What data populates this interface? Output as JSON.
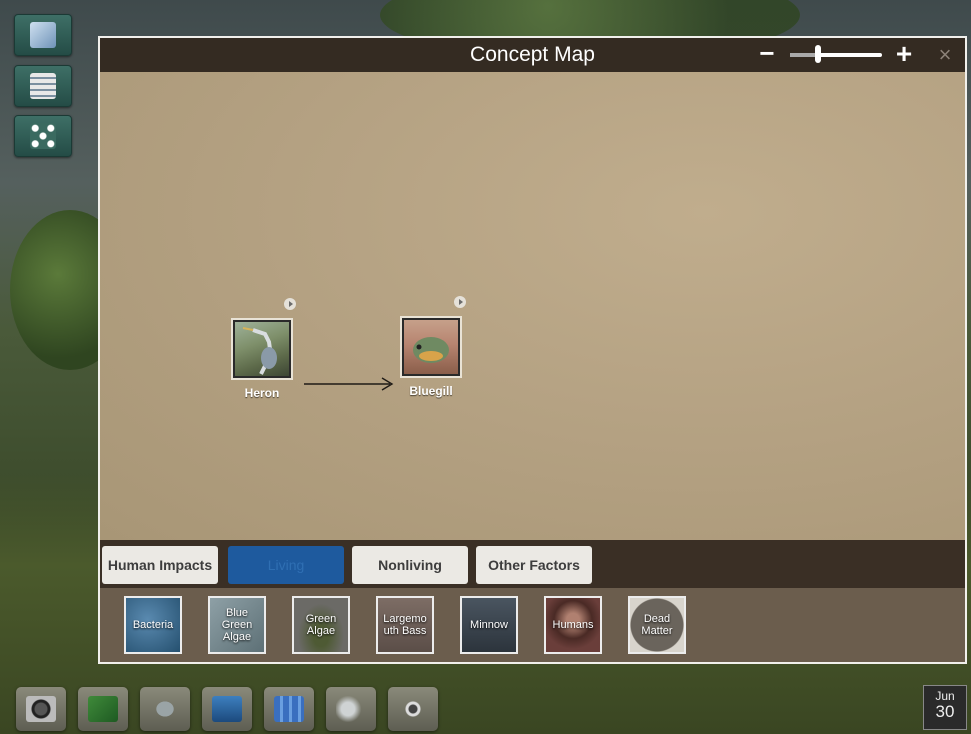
{
  "left_tools": [
    {
      "icon": "notebook-pen-icon"
    },
    {
      "icon": "data-table-icon"
    },
    {
      "icon": "concept-map-icon"
    }
  ],
  "window": {
    "title": "Concept Map",
    "zoom_minus": "−",
    "zoom_plus": "+",
    "zoom_level": 0.3,
    "close": "×"
  },
  "nodes": [
    {
      "label": "Heron"
    },
    {
      "label": "Bluegill"
    }
  ],
  "tabs": [
    {
      "label": "Human Impacts",
      "active": false
    },
    {
      "label": "Living",
      "active": true
    },
    {
      "label": "Nonliving",
      "active": false
    },
    {
      "label": "Other Factors",
      "active": false
    }
  ],
  "tray_items": [
    {
      "label": "Bacteria"
    },
    {
      "label": "Blue Green Algae"
    },
    {
      "label": "Green Algae"
    },
    {
      "label": "Largemouth Bass"
    },
    {
      "label": "Minnow"
    },
    {
      "label": "Humans"
    },
    {
      "label": "Dead Matter"
    }
  ],
  "bottom_tools": [
    {
      "icon": "camera-icon"
    },
    {
      "icon": "field-guide-icon"
    },
    {
      "icon": "submarine-icon"
    },
    {
      "icon": "briefcase-icon"
    },
    {
      "icon": "population-icon"
    },
    {
      "icon": "weather-icon"
    },
    {
      "icon": "sensor-icon"
    }
  ],
  "date": {
    "month": "Jun",
    "day": "30"
  }
}
